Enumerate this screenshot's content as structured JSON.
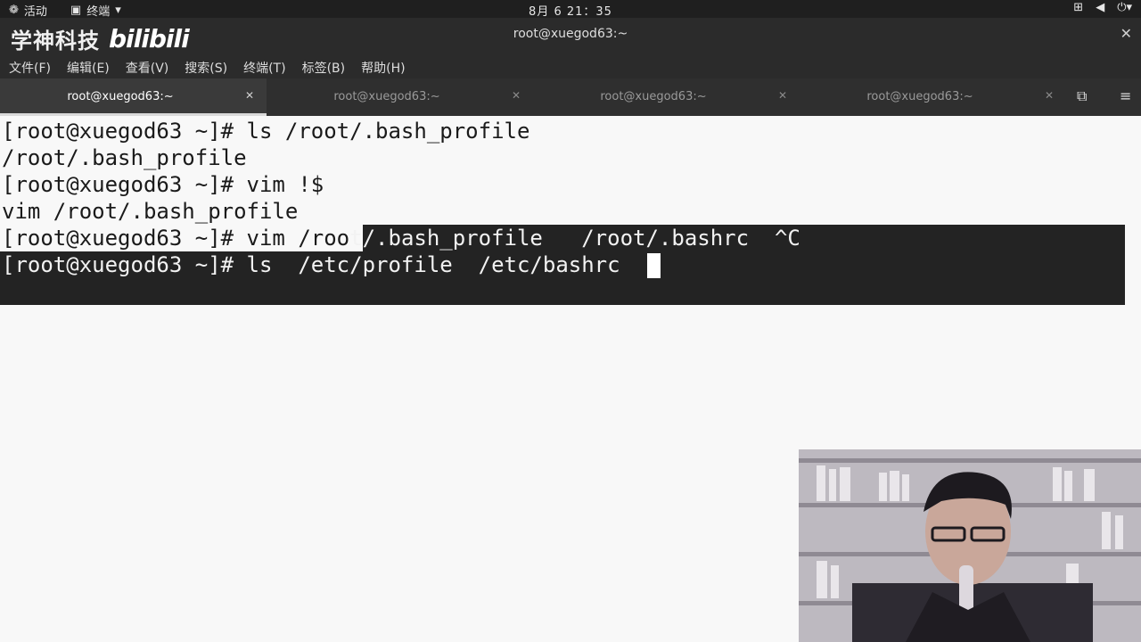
{
  "system_bar": {
    "activities": "活动",
    "app_menu": "终端",
    "clock": "8月 6  21：35"
  },
  "window": {
    "brand_cn": "学神科技",
    "brand_logo": "bilibili",
    "title": "root@xuegod63:~"
  },
  "menu": [
    "文件(F)",
    "编辑(E)",
    "查看(V)",
    "搜索(S)",
    "终端(T)",
    "标签(B)",
    "帮助(H)"
  ],
  "tabs": [
    {
      "label": "root@xuegod63:~",
      "active": true
    },
    {
      "label": "root@xuegod63:~",
      "active": false
    },
    {
      "label": "root@xuegod63:~",
      "active": false
    },
    {
      "label": "root@xuegod63:~",
      "active": false
    }
  ],
  "terminal": {
    "lines": [
      "[root@xuegod63 ~]# ls /root/.bash_profile",
      "/root/.bash_profile",
      "[root@xuegod63 ~]# vim !$",
      "vim /root/.bash_profile"
    ],
    "line5_pre": "[root@xuegod63 ~]# vim /roo",
    "line5_sel": "t/.bash_profile   /root/.bashrc  ^C",
    "line6": "[root@xuegod63 ~]# ls  /etc/profile  /etc/bashrc  "
  },
  "colors": {
    "terminal_bg": "#f8f8f8",
    "selection_bg": "#232323",
    "chrome_bg": "#2b2b2b"
  },
  "icons": [
    "terminal-icon",
    "network-icon",
    "volume-icon",
    "power-icon",
    "new-tab-icon",
    "hamburger-menu-icon",
    "close-icon"
  ]
}
